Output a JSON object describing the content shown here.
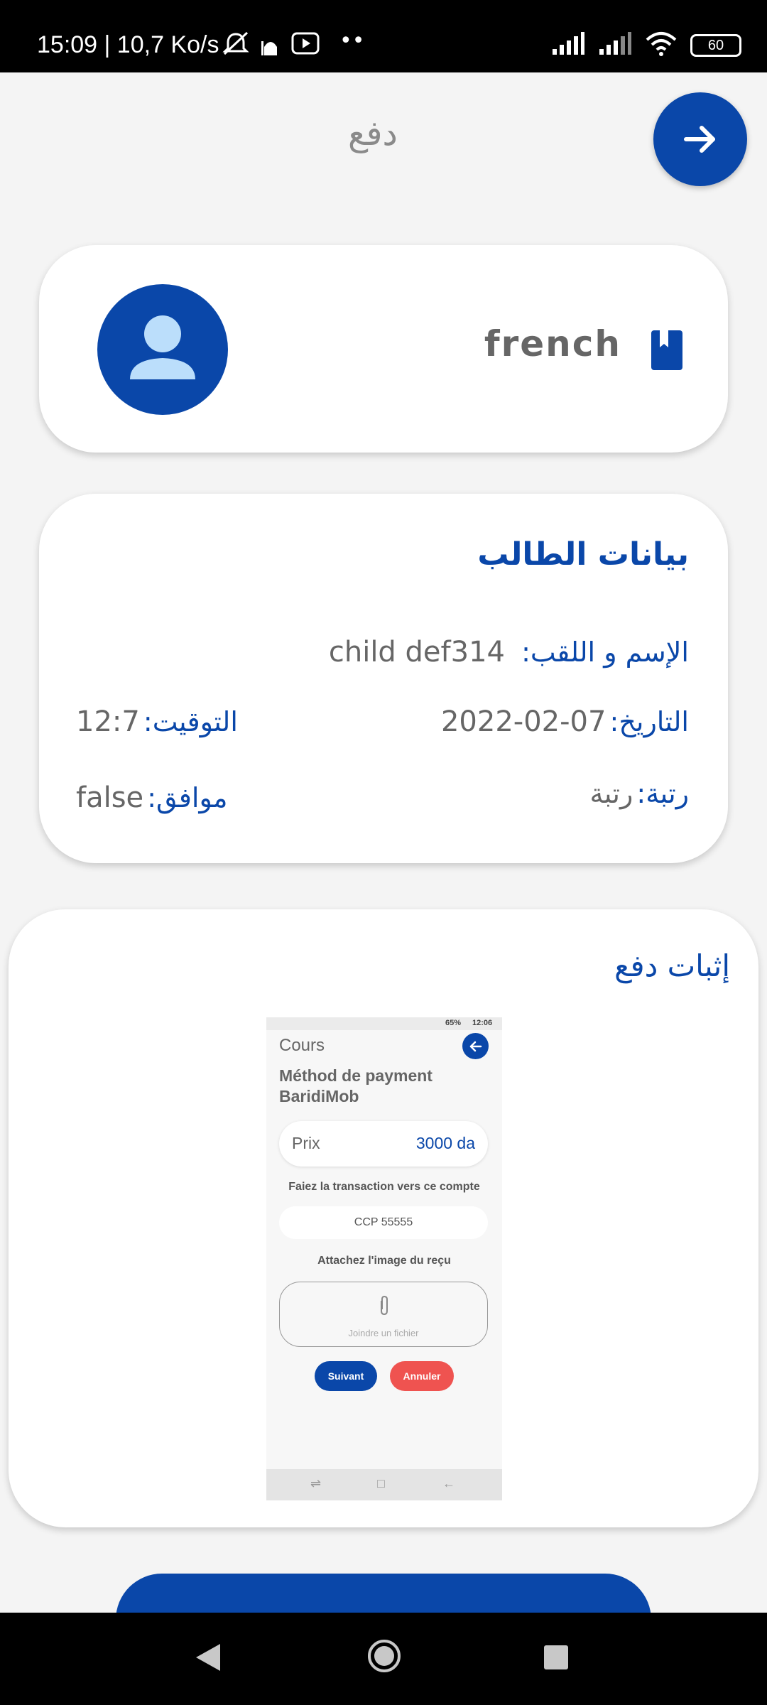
{
  "status_bar": {
    "time": "15:09 | 10,7 Ko/s",
    "battery": "60"
  },
  "header": {
    "title": "دفع"
  },
  "course_card": {
    "subject": "french"
  },
  "student_card": {
    "title": "بيانات الطالب",
    "name_label": "الإسم و اللقب:",
    "name_value": "child def314",
    "date_label": "التاريخ:",
    "date_value": "2022-02-07",
    "time_label": "التوقيت:",
    "time_value": "12:7",
    "rank_label": "رتبة:",
    "rank_value": "رتبة",
    "approved_label": "موافق:",
    "approved_value": "false"
  },
  "proof_card": {
    "title": "إثبات دفع",
    "receipt": {
      "status_battery": "65%",
      "status_time": "12:06",
      "title": "Cours",
      "heading": "Méthod de payment BaridiMob",
      "price_label": "Prix",
      "price_value": "3000 da",
      "transfer_note": "Faiez la transaction vers ce compte",
      "account": "CCP 55555",
      "attach_note": "Attachez l'image du reçu",
      "attach_placeholder": "Joindre un fichier",
      "next_label": "Suivant",
      "cancel_label": "Annuler"
    }
  },
  "colors": {
    "primary": "#0a47a9",
    "danger": "#ef5350",
    "background": "#f4f4f4"
  }
}
